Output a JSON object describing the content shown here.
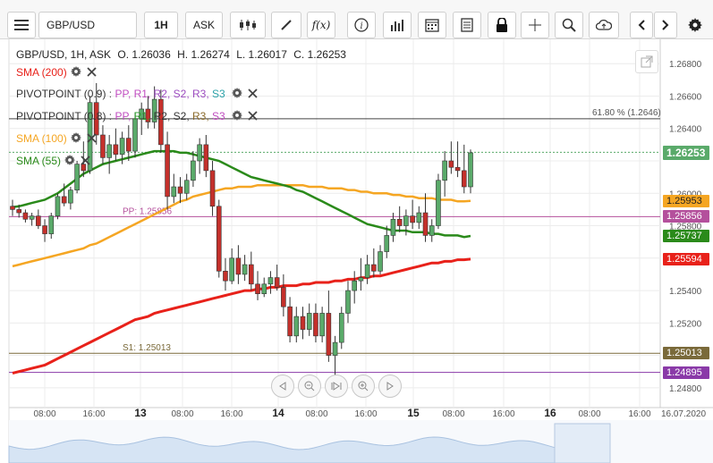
{
  "toolbar": {
    "menu_icon": "hamburger-icon",
    "symbol": "GBP/USD",
    "interval": "1H",
    "price_type": "ASK",
    "icons": [
      "candles-icon",
      "draw-icon",
      "function-icon",
      "info-icon",
      "volume-icon",
      "calendar-icon",
      "notes-icon",
      "lock-icon",
      "crosshair-icon",
      "zoom-icon",
      "cloud-icon",
      "prev-icon",
      "next-icon",
      "gear-icon"
    ],
    "function_label": "f(x)"
  },
  "ohlc": {
    "symbol_line": "GBP/USD, 1H, ASK",
    "open": "O. 1.26036",
    "high": "H. 1.26274",
    "low": "L. 1.26017",
    "close": "C. 1.26253"
  },
  "indicators": [
    {
      "label": "SMA (200)",
      "color": "#e8211a"
    },
    {
      "label": "PIVOTPOINT (0.9)",
      "color": "#333333",
      "levels": [
        {
          "text": "PP",
          "color": "#c04cc0"
        },
        {
          "text": "R1",
          "color": "#c04cc0"
        },
        {
          "text": "R2",
          "color": "#9c4cc0"
        },
        {
          "text": "S2",
          "color": "#9c4cc0"
        },
        {
          "text": "R3",
          "color": "#9c4cc0"
        },
        {
          "text": "S3",
          "color": "#2aa1a8"
        }
      ]
    },
    {
      "label": "PIVOTPOINT (0.8)",
      "color": "#333333",
      "levels": [
        {
          "text": "PP",
          "color": "#c04cc0"
        },
        {
          "text": "R1",
          "color": "#2a9a2a"
        },
        {
          "text": "R2",
          "color": "#333333"
        },
        {
          "text": "S2",
          "color": "#333333"
        },
        {
          "text": "R3",
          "color": "#8a6a2a"
        },
        {
          "text": "S3",
          "color": "#c04cc0"
        }
      ]
    },
    {
      "label": "SMA (100)",
      "color": "#f5a623"
    },
    {
      "label": "SMA (55)",
      "color": "#2a8a1a"
    }
  ],
  "fib_label": "61.80 % (1.2646)",
  "pp_label": "PP: 1.25856",
  "s1_label": "S1: 1.25013",
  "price_axis": [
    "1.26800",
    "1.26600",
    "1.26400",
    "1.26000",
    "1.25800",
    "1.25400",
    "1.25200",
    "1.24800"
  ],
  "price_tags": [
    {
      "text": "1.26253",
      "color": "#5aaa6a"
    },
    {
      "text": "1.25953",
      "color": "#f5a623"
    },
    {
      "text": "1.25856",
      "color": "#b4509c"
    },
    {
      "text": "1.25737",
      "color": "#2a8a1a"
    },
    {
      "text": "1.25594",
      "color": "#e8211a"
    },
    {
      "text": "1.25013",
      "color": "#7a6a3a"
    },
    {
      "text": "1.24895",
      "color": "#8a3aa8"
    }
  ],
  "time_axis": [
    "08:00",
    "16:00",
    "13",
    "08:00",
    "16:00",
    "14",
    "08:00",
    "16:00",
    "15",
    "08:00",
    "16:00",
    "16",
    "08:00",
    "16:00",
    "16.07.2020"
  ],
  "nav_icons": [
    "scroll-left-icon",
    "zoom-out-icon",
    "reset-icon",
    "zoom-in-icon",
    "scroll-right-icon"
  ],
  "chart_data": {
    "type": "candlestick",
    "y_range": [
      1.247,
      1.2695
    ],
    "candles": [
      [
        1.2592,
        1.2596,
        1.2586,
        1.259
      ],
      [
        1.259,
        1.2593,
        1.2585,
        1.2588
      ],
      [
        1.2588,
        1.259,
        1.2582,
        1.2584
      ],
      [
        1.2584,
        1.2588,
        1.258,
        1.2586
      ],
      [
        1.2586,
        1.259,
        1.2578,
        1.258
      ],
      [
        1.258,
        1.2584,
        1.257,
        1.2575
      ],
      [
        1.2575,
        1.2588,
        1.2572,
        1.2586
      ],
      [
        1.2586,
        1.26,
        1.2584,
        1.2598
      ],
      [
        1.2598,
        1.2606,
        1.2592,
        1.2594
      ],
      [
        1.2594,
        1.2604,
        1.259,
        1.2602
      ],
      [
        1.2602,
        1.262,
        1.26,
        1.2618
      ],
      [
        1.2618,
        1.2632,
        1.261,
        1.2614
      ],
      [
        1.2614,
        1.266,
        1.2612,
        1.2656
      ],
      [
        1.2656,
        1.2668,
        1.263,
        1.2636
      ],
      [
        1.2636,
        1.2642,
        1.2618,
        1.2622
      ],
      [
        1.2622,
        1.2636,
        1.2612,
        1.263
      ],
      [
        1.263,
        1.264,
        1.262,
        1.2624
      ],
      [
        1.2624,
        1.2638,
        1.2618,
        1.2634
      ],
      [
        1.2634,
        1.2642,
        1.262,
        1.2626
      ],
      [
        1.2626,
        1.265,
        1.2622,
        1.2646
      ],
      [
        1.2646,
        1.2656,
        1.2636,
        1.2652
      ],
      [
        1.2652,
        1.266,
        1.264,
        1.2644
      ],
      [
        1.2644,
        1.2666,
        1.264,
        1.2658
      ],
      [
        1.2658,
        1.2664,
        1.2625,
        1.263
      ],
      [
        1.263,
        1.2638,
        1.259,
        1.2598
      ],
      [
        1.2598,
        1.2612,
        1.2594,
        1.2604
      ],
      [
        1.2604,
        1.261,
        1.2594,
        1.26
      ],
      [
        1.26,
        1.2612,
        1.2596,
        1.2608
      ],
      [
        1.2608,
        1.2626,
        1.2604,
        1.262
      ],
      [
        1.262,
        1.2634,
        1.2612,
        1.263
      ],
      [
        1.263,
        1.2636,
        1.261,
        1.2614
      ],
      [
        1.2614,
        1.262,
        1.2586,
        1.2592
      ],
      [
        1.2592,
        1.2596,
        1.2548,
        1.2552
      ],
      [
        1.2552,
        1.256,
        1.254,
        1.2546
      ],
      [
        1.2546,
        1.2566,
        1.2544,
        1.256
      ],
      [
        1.256,
        1.2568,
        1.2544,
        1.255
      ],
      [
        1.255,
        1.2562,
        1.2546,
        1.2556
      ],
      [
        1.2556,
        1.2564,
        1.254,
        1.2544
      ],
      [
        1.2544,
        1.2552,
        1.2534,
        1.2538
      ],
      [
        1.2538,
        1.2548,
        1.2536,
        1.2544
      ],
      [
        1.2544,
        1.2552,
        1.2538,
        1.2548
      ],
      [
        1.2548,
        1.2556,
        1.254,
        1.2542
      ],
      [
        1.2542,
        1.255,
        1.2524,
        1.253
      ],
      [
        1.253,
        1.2536,
        1.2508,
        1.2512
      ],
      [
        1.2512,
        1.253,
        1.2508,
        1.2524
      ],
      [
        1.2524,
        1.253,
        1.251,
        1.2516
      ],
      [
        1.2516,
        1.2532,
        1.2512,
        1.2526
      ],
      [
        1.2526,
        1.2532,
        1.2508,
        1.2512
      ],
      [
        1.2512,
        1.253,
        1.2508,
        1.2526
      ],
      [
        1.2526,
        1.254,
        1.2496,
        1.25
      ],
      [
        1.25,
        1.2512,
        1.248,
        1.2508
      ],
      [
        1.2508,
        1.253,
        1.2504,
        1.2526
      ],
      [
        1.2526,
        1.2546,
        1.252,
        1.254
      ],
      [
        1.254,
        1.2552,
        1.2532,
        1.2546
      ],
      [
        1.2546,
        1.256,
        1.254,
        1.2548
      ],
      [
        1.2548,
        1.2562,
        1.2544,
        1.2556
      ],
      [
        1.2556,
        1.2566,
        1.2548,
        1.2552
      ],
      [
        1.2552,
        1.2568,
        1.255,
        1.2564
      ],
      [
        1.2564,
        1.258,
        1.256,
        1.2574
      ],
      [
        1.2574,
        1.2588,
        1.257,
        1.2584
      ],
      [
        1.2584,
        1.2592,
        1.2576,
        1.258
      ],
      [
        1.258,
        1.259,
        1.2574,
        1.2586
      ],
      [
        1.2586,
        1.2596,
        1.2578,
        1.2582
      ],
      [
        1.2582,
        1.2592,
        1.2578,
        1.2588
      ],
      [
        1.2588,
        1.26,
        1.257,
        1.2574
      ],
      [
        1.2574,
        1.2584,
        1.257,
        1.258
      ],
      [
        1.258,
        1.2612,
        1.2578,
        1.2608
      ],
      [
        1.2608,
        1.2626,
        1.2598,
        1.262
      ],
      [
        1.262,
        1.2632,
        1.2612,
        1.2616
      ],
      [
        1.2616,
        1.2632,
        1.261,
        1.2614
      ],
      [
        1.2614,
        1.263,
        1.26,
        1.2604
      ],
      [
        1.2604,
        1.2627,
        1.26,
        1.2625
      ]
    ],
    "sma55": [
      1.25915,
      1.2592,
      1.2593,
      1.2594,
      1.2595,
      1.2596,
      1.2598,
      1.26,
      1.2603,
      1.2606,
      1.2609,
      1.2612,
      1.2614,
      1.2616,
      1.2618,
      1.2619,
      1.262,
      1.2621,
      1.2622,
      1.2623,
      1.2624,
      1.2625,
      1.2626,
      1.2626,
      1.2626,
      1.2626,
      1.2625,
      1.2625,
      1.2624,
      1.2623,
      1.2622,
      1.2621,
      1.262,
      1.2618,
      1.2616,
      1.2614,
      1.2612,
      1.261,
      1.2609,
      1.2608,
      1.2607,
      1.2606,
      1.2605,
      1.2604,
      1.2602,
      1.2601,
      1.2599,
      1.2597,
      1.2595,
      1.2593,
      1.2591,
      1.2589,
      1.2587,
      1.2585,
      1.2583,
      1.2581,
      1.258,
      1.2579,
      1.2578,
      1.2577,
      1.2577,
      1.2577,
      1.2576,
      1.2576,
      1.2576,
      1.2575,
      1.2575,
      1.2574,
      1.2574,
      1.2574,
      1.2573,
      1.25737
    ],
    "sma100": [
      1.2555,
      1.2556,
      1.2557,
      1.2558,
      1.2559,
      1.256,
      1.2561,
      1.2562,
      1.2563,
      1.2564,
      1.2565,
      1.2566,
      1.2568,
      1.2569,
      1.2571,
      1.2573,
      1.2575,
      1.2577,
      1.2579,
      1.2581,
      1.2583,
      1.2585,
      1.2587,
      1.2589,
      1.2591,
      1.2593,
      1.2595,
      1.2596,
      1.2598,
      1.2599,
      1.26,
      1.2601,
      1.2602,
      1.2603,
      1.2603,
      1.2604,
      1.2604,
      1.2604,
      1.2605,
      1.2605,
      1.2605,
      1.2605,
      1.2605,
      1.2605,
      1.2605,
      1.2605,
      1.2604,
      1.2604,
      1.2604,
      1.2603,
      1.2603,
      1.2603,
      1.2602,
      1.2602,
      1.2601,
      1.2601,
      1.26,
      1.26,
      1.26,
      1.2599,
      1.2599,
      1.2598,
      1.2598,
      1.2597,
      1.2597,
      1.2597,
      1.2596,
      1.2596,
      1.2596,
      1.2595,
      1.2595,
      1.25953
    ],
    "sma200": [
      1.2489,
      1.249,
      1.2491,
      1.2492,
      1.2493,
      1.2494,
      1.2496,
      1.2498,
      1.25,
      1.2502,
      1.2504,
      1.2506,
      1.2508,
      1.251,
      1.2512,
      1.2514,
      1.2516,
      1.2518,
      1.252,
      1.2522,
      1.2523,
      1.2524,
      1.2526,
      1.2527,
      1.2528,
      1.2529,
      1.253,
      1.2531,
      1.2532,
      1.2533,
      1.2534,
      1.2535,
      1.2536,
      1.2537,
      1.2538,
      1.2539,
      1.254,
      1.254,
      1.2541,
      1.2541,
      1.2542,
      1.2542,
      1.2543,
      1.2543,
      1.2543,
      1.2544,
      1.2544,
      1.2545,
      1.2545,
      1.2545,
      1.2546,
      1.2546,
      1.2547,
      1.2547,
      1.2548,
      1.2548,
      1.2549,
      1.2549,
      1.255,
      1.2551,
      1.2552,
      1.2553,
      1.2554,
      1.2555,
      1.2556,
      1.2557,
      1.2557,
      1.2558,
      1.2558,
      1.2559,
      1.2559,
      1.25594
    ],
    "lines": {
      "fib": 1.2646,
      "pp": 1.25856,
      "s1": 1.25013,
      "low": 1.24895,
      "last": 1.26253
    }
  }
}
